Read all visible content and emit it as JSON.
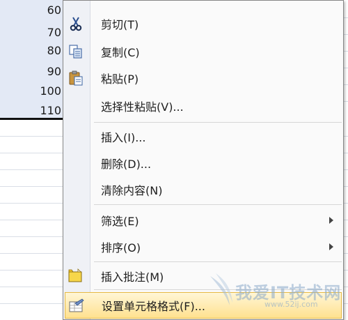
{
  "sheet": {
    "cells": [
      "60",
      "70",
      "80",
      "90",
      "100",
      "110"
    ]
  },
  "context_menu": {
    "items": [
      {
        "label": "剪切(T)",
        "icon": "scissors-icon"
      },
      {
        "label": "复制(C)",
        "icon": "copy-icon"
      },
      {
        "label": "粘贴(P)",
        "icon": "paste-icon"
      },
      {
        "label": "选择性粘贴(V)..."
      },
      {
        "label": "插入(I)..."
      },
      {
        "label": "删除(D)..."
      },
      {
        "label": "清除内容(N)"
      },
      {
        "label": "筛选(E)",
        "submenu": true
      },
      {
        "label": "排序(O)",
        "submenu": true
      },
      {
        "label": "插入批注(M)",
        "icon": "comment-icon"
      },
      {
        "label": "设置单元格格式(F)...",
        "icon": "format-cells-icon",
        "highlighted": true
      }
    ]
  },
  "watermark": {
    "text": "我爱IT技术网",
    "sub": "www.52ij.com"
  },
  "colors": {
    "selection": "#e3e9f5",
    "hover_top": "#fff6d6",
    "hover_bottom": "#ffe18f",
    "gutter": "#eff1f6"
  }
}
